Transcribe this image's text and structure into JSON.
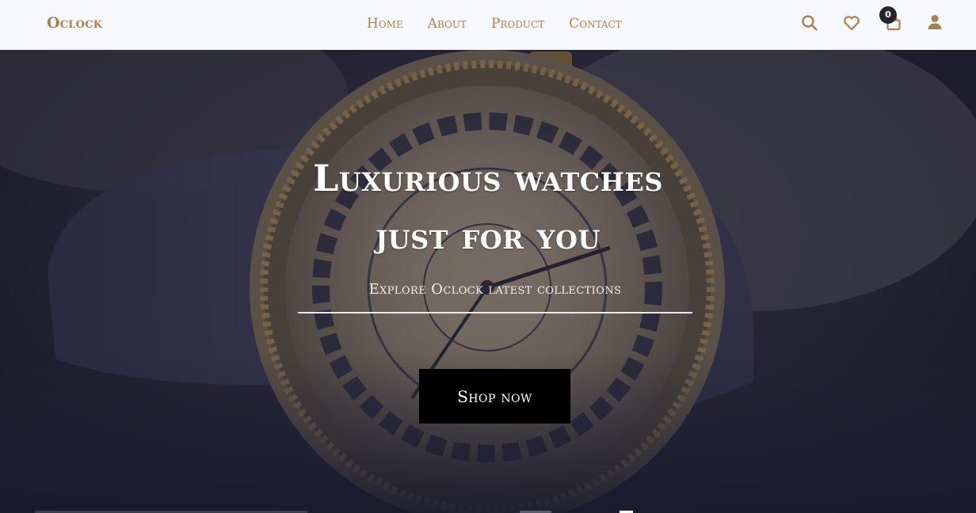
{
  "brand": {
    "name": "Oclock"
  },
  "nav": {
    "links": [
      {
        "label": "Home"
      },
      {
        "label": "About"
      },
      {
        "label": "Product"
      },
      {
        "label": "Contact"
      }
    ]
  },
  "header_icons": {
    "search": "search-icon",
    "wishlist": "heart-icon",
    "cart": "shopping-bag-icon",
    "account": "user-icon",
    "cart_count": "0"
  },
  "hero": {
    "title_line1": "Luxurious watches",
    "title_line2": "just for you",
    "subtitle": "Explore Oclock latest collections",
    "cta_label": "Shop now",
    "background": "wristwatch-photo"
  },
  "colors": {
    "accent": "#a9824b",
    "navbar_bg": "#f7f8fc",
    "button_bg": "#000000",
    "badge_bg": "#26262a"
  }
}
